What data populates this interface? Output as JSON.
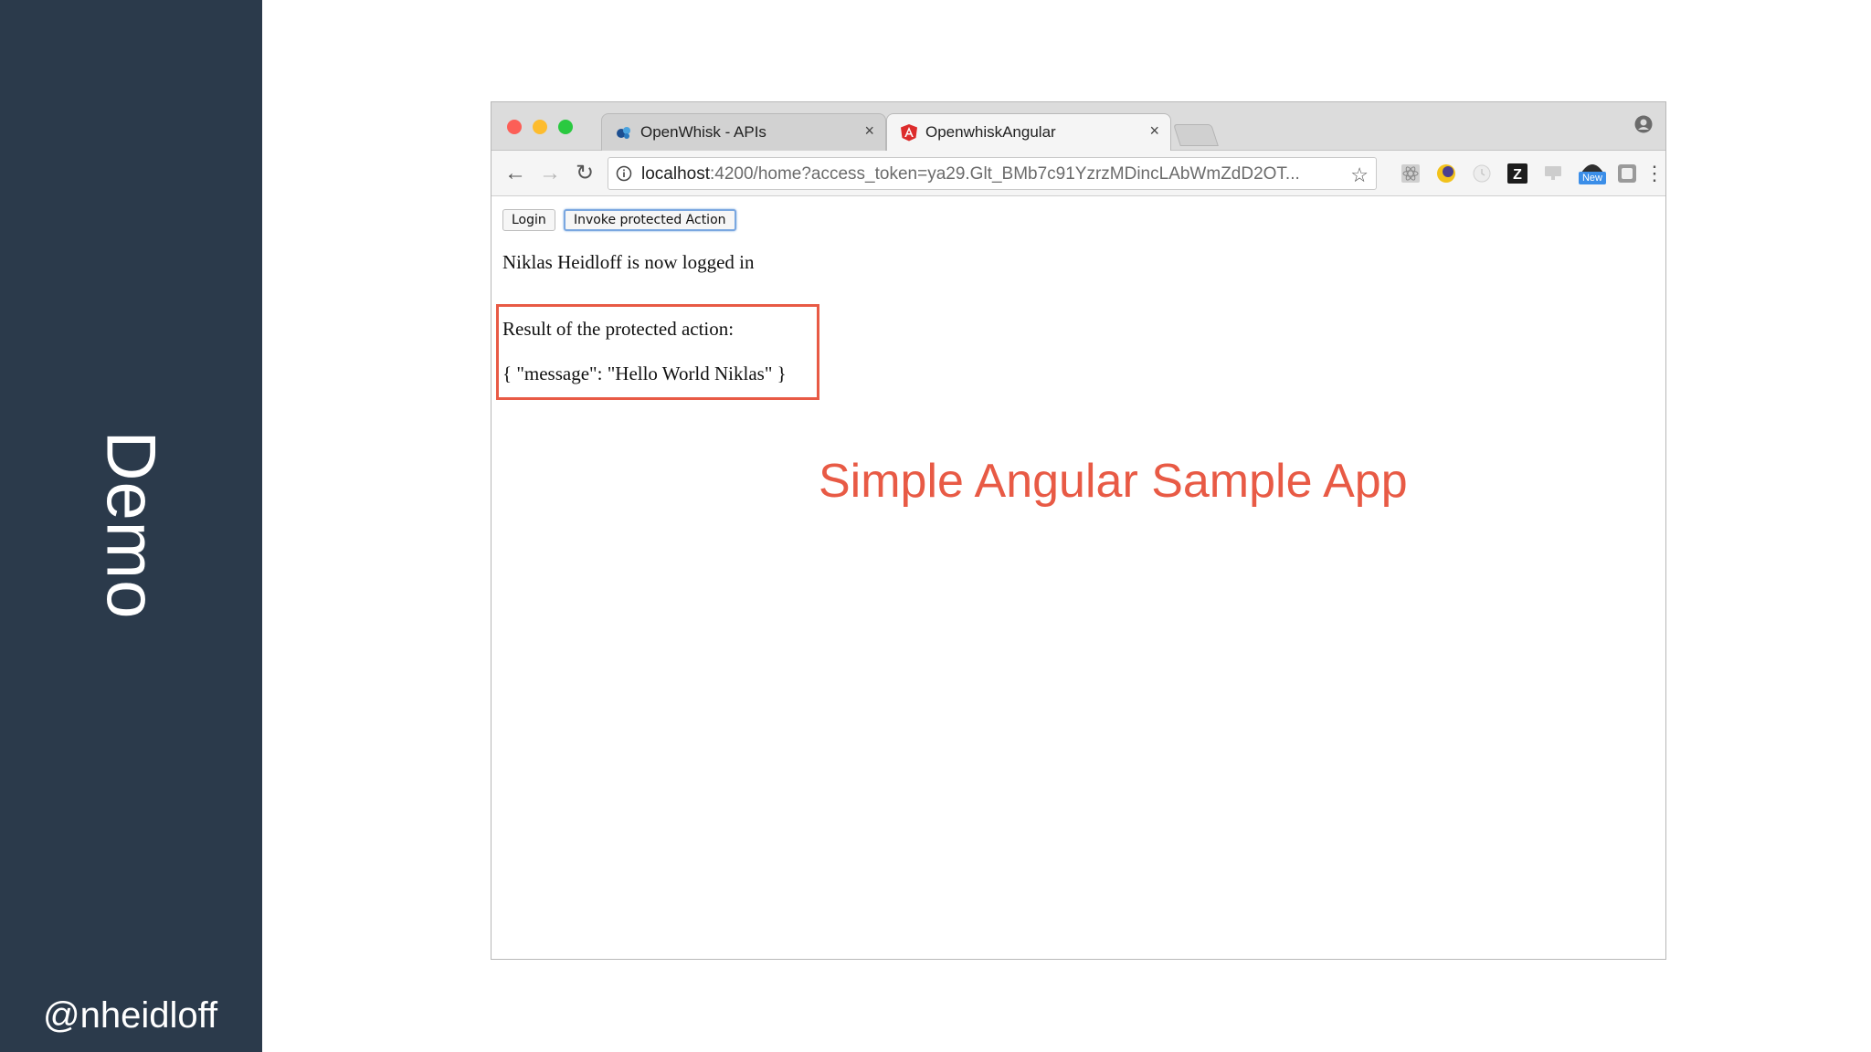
{
  "slide": {
    "sidebar_title": "Demo",
    "handle": "@nheidloff",
    "caption": "Simple Angular Sample App",
    "caption_color": "#e85a45",
    "sidebar_color": "#2b3a4b"
  },
  "browser": {
    "tabs": [
      {
        "label": "OpenWhisk - APIs",
        "icon": "openwhisk-favicon",
        "close": "×",
        "active": false
      },
      {
        "label": "OpenwhiskAngular",
        "icon": "angular-favicon",
        "close": "×",
        "active": true
      }
    ],
    "address": {
      "host": "localhost",
      "path": ":4200/home?access_token=ya29.Glt_BMb7c91YzrzMDincLAbWmZdD2OT..."
    },
    "extensions": [
      "react-devtools-icon",
      "moon-icon",
      "clock-icon",
      "z-icon",
      "monitor-icon",
      "new-badge-icon",
      "puzzle-icon"
    ],
    "new_badge": "New"
  },
  "page": {
    "login_button": "Login",
    "invoke_button": "Invoke protected Action",
    "status_text": "Niklas Heidloff is now logged in",
    "result_label": "Result of the protected action:",
    "result_json": "{ \"message\": \"Hello World Niklas\" }"
  }
}
